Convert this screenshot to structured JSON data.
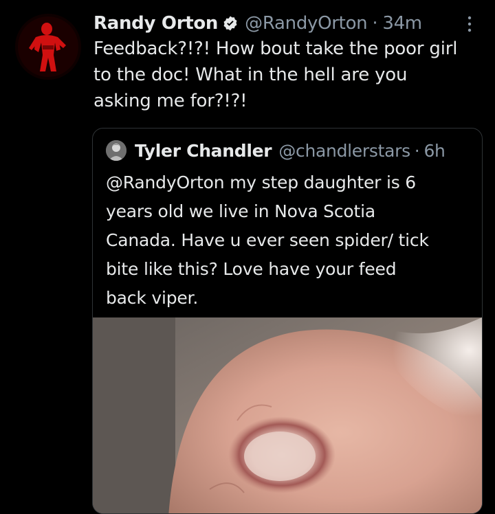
{
  "tweet": {
    "author": {
      "display_name": "Randy Orton",
      "verified": true,
      "handle": "@RandyOrton",
      "avatar_icon": "wrestler-avatar-icon"
    },
    "separator": "·",
    "time": "34m",
    "more_icon": "vertical-ellipsis-icon",
    "text_lines": [
      "Feedback?!?! How bout take the poor girl",
      "to the doc! What in the hell are you",
      "asking me for?!?!"
    ]
  },
  "quoted_tweet": {
    "author": {
      "display_name": "Tyler Chandler",
      "handle": "@chandlerstars",
      "avatar_icon": "user-avatar-icon"
    },
    "separator": "·",
    "time": "6h",
    "text_lines": [
      "@RandyOrton my step daughter is 6",
      "years old we live in Nova Scotia",
      "Canada. Have u ever seen spider/ tick",
      "bite like this? Love have your feed",
      "back viper."
    ],
    "media": {
      "type": "photo",
      "subject_icon": "skin-bite-photo"
    }
  },
  "colors": {
    "background": "#000000",
    "primary_text": "#e7e9ea",
    "secondary_text": "#8b98a5",
    "border": "#2f3336",
    "verified_badge": "#e7e9ea",
    "avatar_red": "#d01010"
  }
}
